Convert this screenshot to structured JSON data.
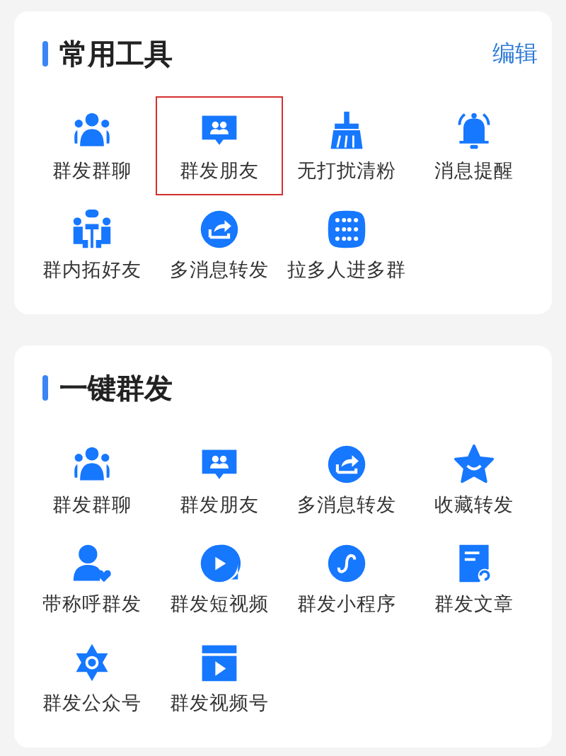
{
  "sections": [
    {
      "title": "常用工具",
      "action": "编辑",
      "items": [
        {
          "label": "群发群聊",
          "kind": "people",
          "highlighted": false
        },
        {
          "label": "群发朋友",
          "kind": "friends",
          "highlighted": true
        },
        {
          "label": "无打扰清粉",
          "kind": "broom",
          "highlighted": false
        },
        {
          "label": "消息提醒",
          "kind": "bell",
          "highlighted": false
        },
        {
          "label": "群内拓好友",
          "kind": "meeting",
          "highlighted": false
        },
        {
          "label": "多消息转发",
          "kind": "share",
          "highlighted": false
        },
        {
          "label": "拉多人进多群",
          "kind": "grid",
          "highlighted": false
        }
      ]
    },
    {
      "title": "一键群发",
      "items": [
        {
          "label": "群发群聊",
          "kind": "people"
        },
        {
          "label": "群发朋友",
          "kind": "friends"
        },
        {
          "label": "多消息转发",
          "kind": "share"
        },
        {
          "label": "收藏转发",
          "kind": "star"
        },
        {
          "label": "带称呼群发",
          "kind": "user-heart"
        },
        {
          "label": "群发短视频",
          "kind": "video"
        },
        {
          "label": "群发小程序",
          "kind": "miniprogram"
        },
        {
          "label": "群发文章",
          "kind": "article"
        },
        {
          "label": "群发公众号",
          "kind": "hexagon"
        },
        {
          "label": "群发视频号",
          "kind": "clapper"
        }
      ]
    }
  ]
}
